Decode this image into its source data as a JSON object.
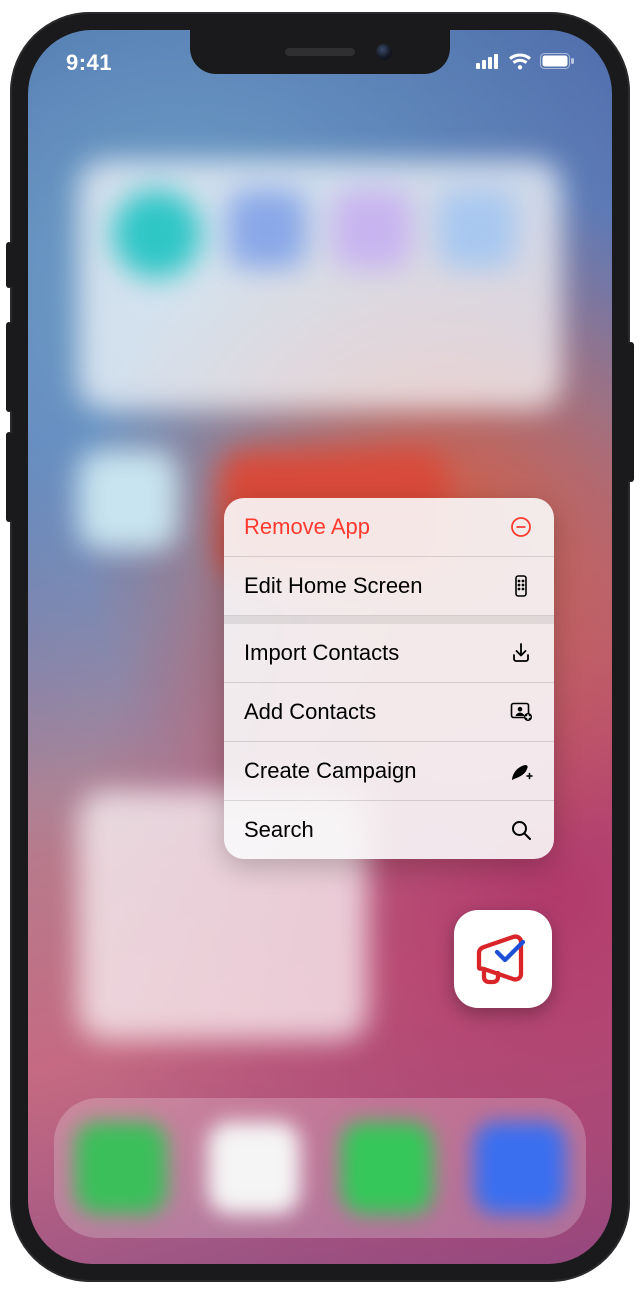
{
  "status": {
    "time": "9:41"
  },
  "menu": {
    "remove": "Remove App",
    "edit": "Edit Home Screen",
    "import": "Import Contacts",
    "add": "Add Contacts",
    "campaign": "Create Campaign",
    "search": "Search"
  },
  "colors": {
    "destructive": "#ff3b30"
  }
}
